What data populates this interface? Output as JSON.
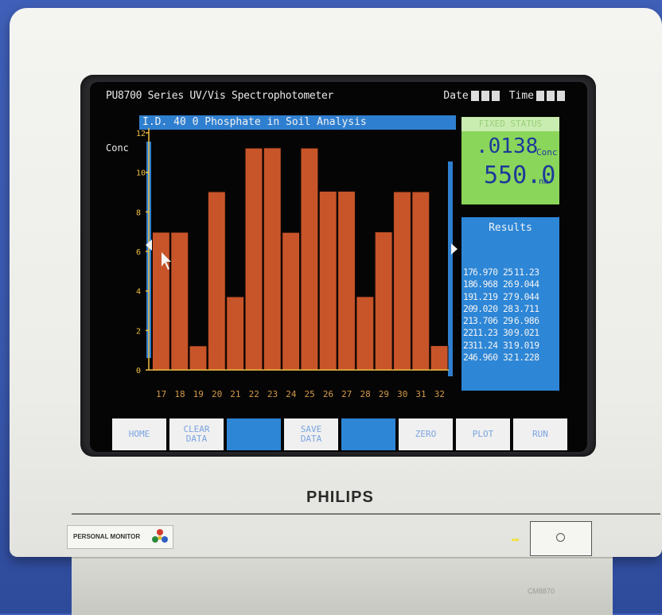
{
  "app": {
    "title": "PU8700 Series UV/Vis Spectrophotometer",
    "date_label": "Date",
    "time_label": "Time",
    "header": "I.D. 40  0  Phosphate in Soil Analysis",
    "y_label": "Conc"
  },
  "status": {
    "header": "FIXED  STATUS",
    "conc_value": ".0138",
    "conc_unit": "Conc",
    "wavelength_value": "550.0",
    "wavelength_unit": "nm"
  },
  "results": {
    "title": "Results",
    "rows": [
      {
        "a_idx": "17",
        "a_val": "6.970",
        "b_idx": "25",
        "b_val": "11.23"
      },
      {
        "a_idx": "18",
        "a_val": "6.968",
        "b_idx": "26",
        "b_val": "9.044"
      },
      {
        "a_idx": "19",
        "a_val": "1.219",
        "b_idx": "27",
        "b_val": "9.044"
      },
      {
        "a_idx": "20",
        "a_val": "9.020",
        "b_idx": "28",
        "b_val": "3.711"
      },
      {
        "a_idx": "21",
        "a_val": "3.706",
        "b_idx": "29",
        "b_val": "6.986"
      },
      {
        "a_idx": "22",
        "a_val": "11.23",
        "b_idx": "30",
        "b_val": "9.021"
      },
      {
        "a_idx": "23",
        "a_val": "11.24",
        "b_idx": "31",
        "b_val": "9.019"
      },
      {
        "a_idx": "24",
        "a_val": "6.960",
        "b_idx": "32",
        "b_val": "1.228"
      }
    ]
  },
  "function_keys": [
    {
      "label1": "HOME",
      "label2": "",
      "style": "light"
    },
    {
      "label1": "CLEAR",
      "label2": "DATA",
      "style": "light"
    },
    {
      "label1": "",
      "label2": "",
      "style": "blue"
    },
    {
      "label1": "SAVE",
      "label2": "DATA",
      "style": "light"
    },
    {
      "label1": "",
      "label2": "",
      "style": "blue"
    },
    {
      "label1": "ZERO",
      "label2": "",
      "style": "light"
    },
    {
      "label1": "PLOT",
      "label2": "",
      "style": "light"
    },
    {
      "label1": "RUN",
      "label2": "",
      "style": "light"
    }
  ],
  "monitor": {
    "brand": "PHILIPS",
    "model_strip": "PERSONAL MONITOR",
    "model_tag": "CM8870"
  },
  "colors": {
    "bar": "#c8552a",
    "axis": "#f0c040",
    "marker_bar": "#2f7fd0",
    "screen_bg": "#050505",
    "status_bg": "#8ad65a",
    "results_bg": "#2d86d6"
  },
  "chart_data": {
    "type": "bar",
    "categories": [
      "17",
      "18",
      "19",
      "20",
      "21",
      "22",
      "23",
      "24",
      "25",
      "26",
      "27",
      "28",
      "29",
      "30",
      "31",
      "32"
    ],
    "values": [
      6.97,
      6.968,
      1.219,
      9.02,
      3.706,
      11.23,
      11.24,
      6.96,
      11.23,
      9.044,
      9.044,
      3.711,
      6.986,
      9.021,
      9.019,
      1.228
    ],
    "title": "I.D. 40  0  Phosphate in Soil Analysis",
    "ylabel": "Conc",
    "ylim": [
      0,
      12
    ],
    "yticks": [
      0,
      2,
      4,
      6,
      8,
      10,
      12
    ],
    "grid": false
  }
}
